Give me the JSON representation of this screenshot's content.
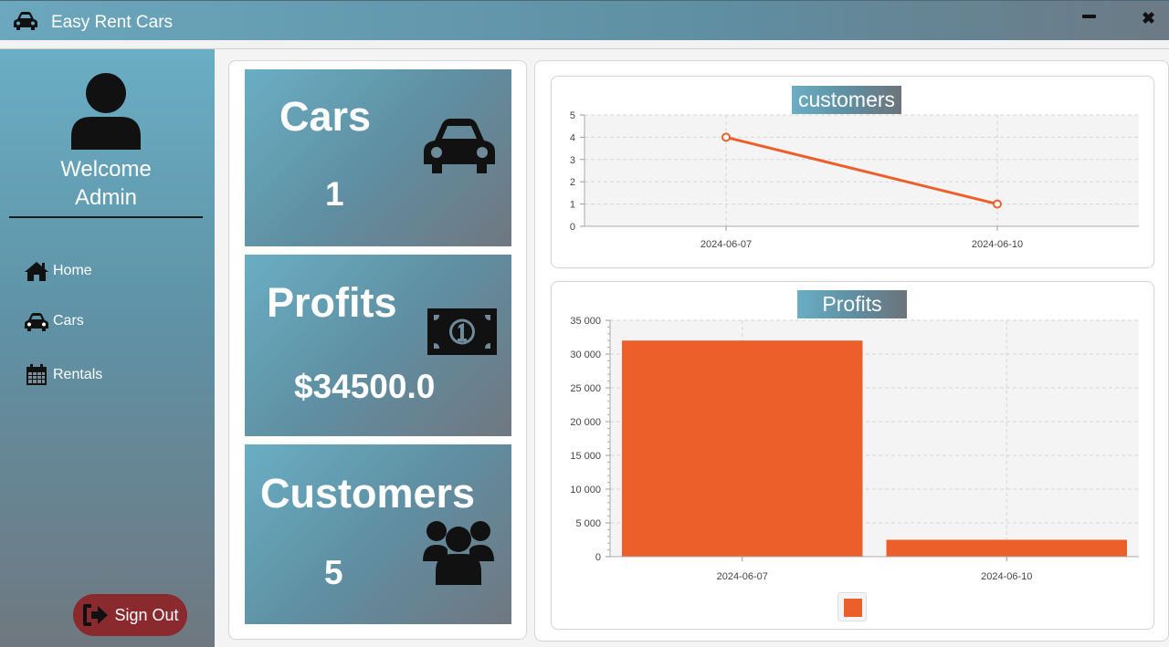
{
  "window": {
    "title": "Easy Rent Cars",
    "icon": "car-icon",
    "minimize_icon": "minimize-icon",
    "close_label": "✖"
  },
  "sidebar": {
    "avatar_icon": "user-icon",
    "welcome_line1": "Welcome",
    "welcome_line2": "Admin",
    "items": [
      {
        "label": "Home",
        "icon": "home-icon"
      },
      {
        "label": "Cars",
        "icon": "car-icon"
      },
      {
        "label": "Rentals",
        "icon": "calendar-icon"
      }
    ],
    "signout": {
      "label": "Sign Out",
      "icon": "sign-out-icon"
    }
  },
  "stats": [
    {
      "label": "Cars",
      "value": "1",
      "icon": "car-icon"
    },
    {
      "label": "Profits",
      "value": "$34500.0",
      "icon": "money-bill-icon"
    },
    {
      "label": "Customers",
      "value": "5",
      "icon": "users-icon"
    }
  ],
  "colors": {
    "accent": "#ec5f2b",
    "sidebar_top": "#6aaec4",
    "sidebar_bottom": "#6f7880",
    "signout_bg": "#8a2a2e"
  },
  "chart_data": [
    {
      "type": "line",
      "title": "customers",
      "x": [
        "2024-06-07",
        "2024-06-10"
      ],
      "series": [
        {
          "values": [
            4,
            1
          ]
        }
      ],
      "ylim": [
        0,
        5
      ],
      "yticks": [
        0,
        1,
        2,
        3,
        4,
        5
      ],
      "grid": true
    },
    {
      "type": "bar",
      "title": "Profits",
      "categories": [
        "2024-06-07",
        "2024-06-10"
      ],
      "series": [
        {
          "values": [
            32000,
            2500
          ]
        }
      ],
      "ylim": [
        0,
        35000
      ],
      "yticks": [
        "0",
        "5 000",
        "10 000",
        "15 000",
        "20 000",
        "25 000",
        "30 000",
        "35 000"
      ],
      "grid": true,
      "legend": "bottom"
    }
  ]
}
